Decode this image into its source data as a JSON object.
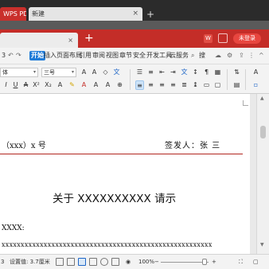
{
  "window_tabs": {
    "wps_tab_label": "WPS PDF",
    "new_tab_label": "新建",
    "close_glyph": "×",
    "add_glyph": "+"
  },
  "doc_tabs": {
    "active_tab_label": "",
    "close_glyph": "×",
    "add_glyph": "+",
    "login_label": "未登录"
  },
  "menu": {
    "left_number": "3",
    "items": [
      "开始",
      "插入",
      "页面布局",
      "引用",
      "审阅",
      "视图",
      "章节",
      "安全",
      "开发工具",
      "云服务"
    ],
    "search_label": "搜"
  },
  "toolbar": {
    "font_name": "体",
    "font_size": "三号",
    "dropdown_caret": "▾"
  },
  "document": {
    "doc_number": "（xxx）x 号",
    "signer": "签发人：张  三",
    "title": "关于 XXXXXXXXXX 请示",
    "addressee": "XXXX:",
    "body_line": "xxxxxxxxxxxxxxxxxxxxxxxxxxxxxxxxxxxxxxxxxxxxxxxxxxxxxxx"
  },
  "status": {
    "page_number": "3",
    "position_text": "设置值: 3.7厘米",
    "zoom": "100%",
    "minus": "−",
    "plus": "+"
  },
  "colors": {
    "accent_red": "#c42d28",
    "ribbon_blue": "#1f7bd8",
    "rule_red": "#b2261f"
  }
}
